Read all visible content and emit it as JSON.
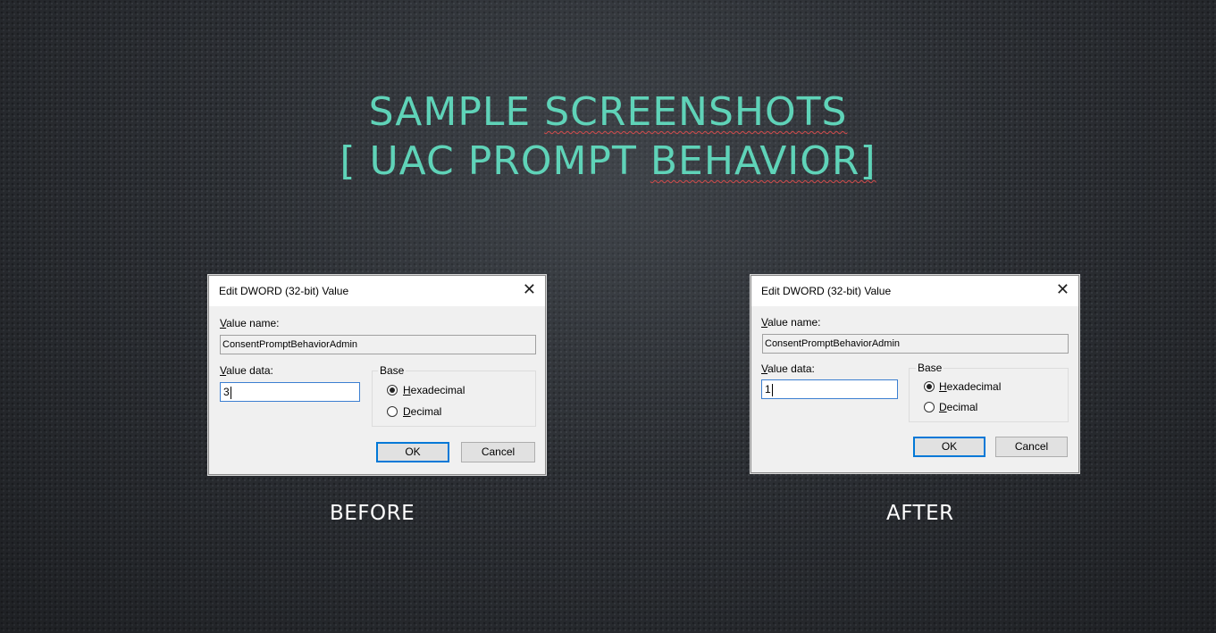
{
  "slide": {
    "title_line1_a": "SAMPLE",
    "title_line1_b": "SCREENSHOTS",
    "title_line2_a": "[ UAC PROMPT",
    "title_line2_b": "BEHAVIOR]",
    "title_color": "#5fd3b8"
  },
  "before": {
    "caption": "BEFORE",
    "dialog": {
      "title": "Edit DWORD (32-bit) Value",
      "close_icon": "close-icon",
      "value_name_label_u": "V",
      "value_name_label": "alue name:",
      "value_name": "ConsentPromptBehaviorAdmin",
      "value_data_label_u": "V",
      "value_data_label": "alue data:",
      "value_data": "3",
      "base_label": "Base",
      "hex_label_u": "H",
      "hex_label": "exadecimal",
      "dec_label_u": "D",
      "dec_label": "ecimal",
      "selected_base": "Hexadecimal",
      "ok_label": "OK",
      "cancel_label": "Cancel"
    }
  },
  "after": {
    "caption": "AFTER",
    "dialog": {
      "title": "Edit DWORD (32-bit) Value",
      "close_icon": "close-icon",
      "value_name_label_u": "V",
      "value_name_label": "alue name:",
      "value_name": "ConsentPromptBehaviorAdmin",
      "value_data_label_u": "V",
      "value_data_label": "alue data:",
      "value_data": "1",
      "base_label": "Base",
      "hex_label_u": "H",
      "hex_label": "exadecimal",
      "dec_label_u": "D",
      "dec_label": "ecimal",
      "selected_base": "Hexadecimal",
      "ok_label": "OK",
      "cancel_label": "Cancel"
    }
  }
}
